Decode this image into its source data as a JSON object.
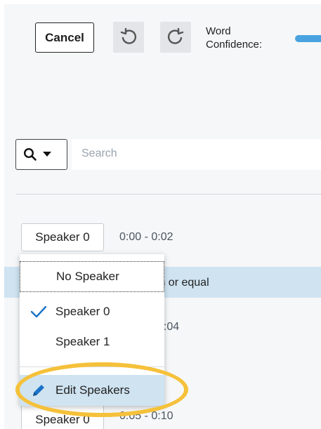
{
  "toolbar": {
    "cancel_label": "Cancel",
    "undo_icon": "undo-icon",
    "redo_icon": "redo-icon",
    "word_confidence_label_1": "Word",
    "word_confidence_label_2": "Confidence:"
  },
  "search": {
    "placeholder": "Search",
    "icon": "search-icon"
  },
  "segments": [
    {
      "speaker": "Speaker 0",
      "time": "0:00 - 0:02",
      "text": "ian or equal"
    },
    {
      "time": "0:04"
    },
    {
      "speaker": "Speaker 0",
      "time": "0:05 - 0:10"
    }
  ],
  "speaker_menu": {
    "items": [
      "No Speaker",
      "Speaker 0",
      "Speaker 1"
    ],
    "selected": "Speaker 0",
    "edit_label": "Edit Speakers"
  },
  "colors": {
    "accent": "#1a73c8",
    "highlight": "#cfe3f1",
    "annotation": "#f5c13a"
  }
}
